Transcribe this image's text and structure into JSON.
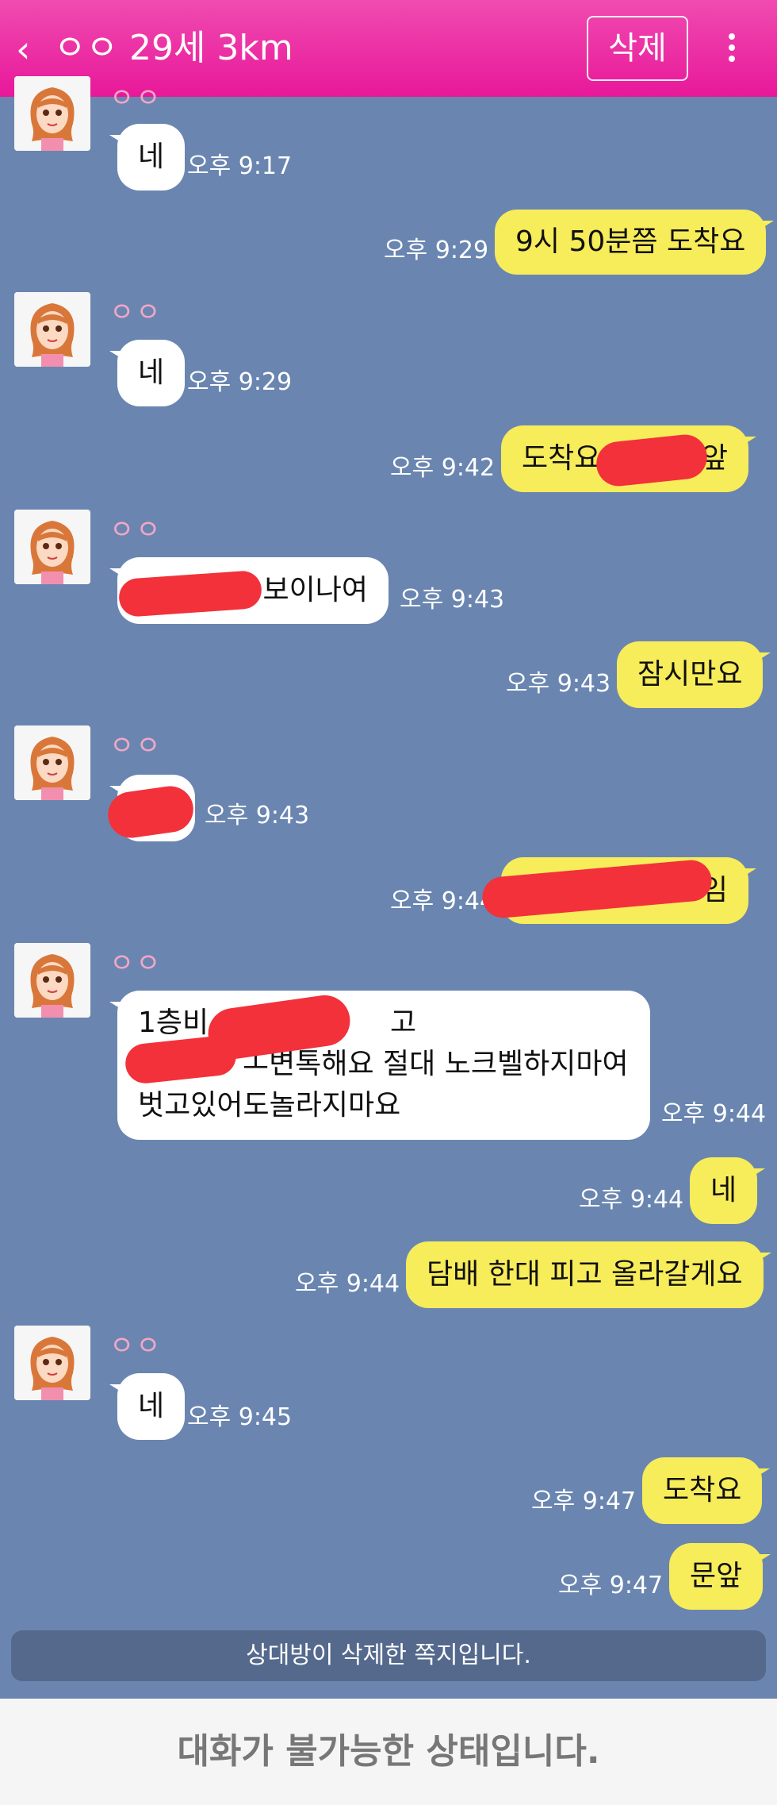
{
  "header": {
    "back_icon": "chevron-left",
    "title": "ㅇㅇ 29세 3km",
    "delete_label": "삭제",
    "more_icon": "vertical-dots"
  },
  "sender": {
    "name": "ㅇㅇ"
  },
  "messages": [
    {
      "dir": "in",
      "text": "네",
      "time": "오후 9:17"
    },
    {
      "dir": "out",
      "text": "9시 50분쯤 도착요",
      "time": "오후 9:29"
    },
    {
      "dir": "in",
      "text": "네",
      "time": "오후 9:29"
    },
    {
      "dir": "out",
      "text": "도착요",
      "text2": "앞",
      "time": "오후 9:42"
    },
    {
      "dir": "in",
      "text": "보이나여",
      "time": "오후 9:43"
    },
    {
      "dir": "out",
      "text": "잠시만요",
      "time": "오후 9:43"
    },
    {
      "dir": "in",
      "text": "",
      "time": "오후 9:43"
    },
    {
      "dir": "out",
      "text": "임",
      "time": "오후 9:44"
    },
    {
      "dir": "in",
      "line1a": "1층비",
      "line1b": "고",
      "line2": "ㅗ변톡해요 절대 노크벨하지마여",
      "line3": "벗고있어도놀라지마요",
      "time": "오후 9:44"
    },
    {
      "dir": "out",
      "text": "네",
      "time": "오후 9:44"
    },
    {
      "dir": "out",
      "text": "담배 한대 피고 올라갈게요",
      "time": "오후 9:44"
    },
    {
      "dir": "in",
      "text": "네",
      "time": "오후 9:45"
    },
    {
      "dir": "out",
      "text": "도착요",
      "time": "오후 9:47"
    },
    {
      "dir": "out",
      "text": "문앞",
      "time": "오후 9:47"
    }
  ],
  "notice": "상대방이 삭제한 쪽지입니다.",
  "footer": "대화가 불가능한 상태입니다.",
  "colors": {
    "header": "#e8189a",
    "background": "#6a86b0",
    "outgoing_bubble": "#f7ec5a",
    "incoming_bubble": "#ffffff",
    "redaction": "#f2313a"
  }
}
